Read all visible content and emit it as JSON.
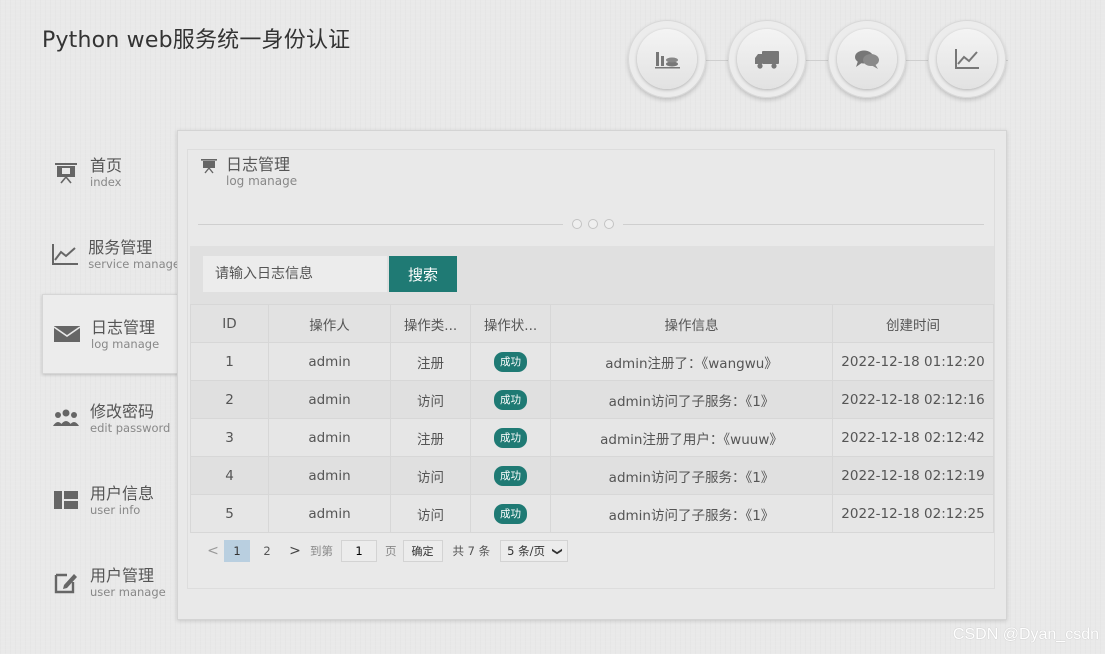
{
  "app": {
    "title": "Python web服务统一身份认证"
  },
  "top_nav": [
    {
      "icon": "coins-chart-icon"
    },
    {
      "icon": "truck-icon"
    },
    {
      "icon": "chat-bubbles-icon"
    },
    {
      "icon": "line-chart-icon"
    }
  ],
  "sidebar": {
    "items": [
      {
        "zh": "首页",
        "en": "index",
        "icon": "presentation-icon",
        "active": false
      },
      {
        "zh": "服务管理",
        "en": "service manage",
        "icon": "line-chart-icon",
        "active": false
      },
      {
        "zh": "日志管理",
        "en": "log manage",
        "icon": "envelope-icon",
        "active": true
      },
      {
        "zh": "修改密码",
        "en": "edit password",
        "icon": "users-icon",
        "active": false
      },
      {
        "zh": "用户信息",
        "en": "user info",
        "icon": "grid-icon",
        "active": false
      },
      {
        "zh": "用户管理",
        "en": "user manage",
        "icon": "edit-icon",
        "active": false
      }
    ]
  },
  "panel": {
    "title_zh": "日志管理",
    "title_en": "log manage"
  },
  "search": {
    "placeholder": "请输入日志信息",
    "button_label": "搜索"
  },
  "table": {
    "headers": [
      "ID",
      "操作人",
      "操作类...",
      "操作状...",
      "操作信息",
      "创建时间"
    ],
    "rows": [
      {
        "id": "1",
        "operator": "admin",
        "type": "注册",
        "status": "成功",
        "info": "admin注册了：《wangwu》",
        "time": "2022-12-18 01:12:20"
      },
      {
        "id": "2",
        "operator": "admin",
        "type": "访问",
        "status": "成功",
        "info": "admin访问了子服务：《1》",
        "time": "2022-12-18 02:12:16"
      },
      {
        "id": "3",
        "operator": "admin",
        "type": "注册",
        "status": "成功",
        "info": "admin注册了用户：《wuuw》",
        "time": "2022-12-18 02:12:42"
      },
      {
        "id": "4",
        "operator": "admin",
        "type": "访问",
        "status": "成功",
        "info": "admin访问了子服务：《1》",
        "time": "2022-12-18 02:12:19"
      },
      {
        "id": "5",
        "operator": "admin",
        "type": "访问",
        "status": "成功",
        "info": "admin访问了子服务：《1》",
        "time": "2022-12-18 02:12:25"
      }
    ]
  },
  "pager": {
    "prev": "<",
    "pages": [
      "1",
      "2"
    ],
    "current_page": "1",
    "next": ">",
    "goto_label": "到第",
    "goto_value": "1",
    "page_unit": "页",
    "confirm_label": "确定",
    "total_label": "共 7 条",
    "page_size_label": "5 条/页"
  },
  "watermark": "CSDN @Dyan_csdn",
  "colors": {
    "accent": "#1f7a74",
    "active_page": "#b9cfe0",
    "background": "#e9e9e9"
  }
}
